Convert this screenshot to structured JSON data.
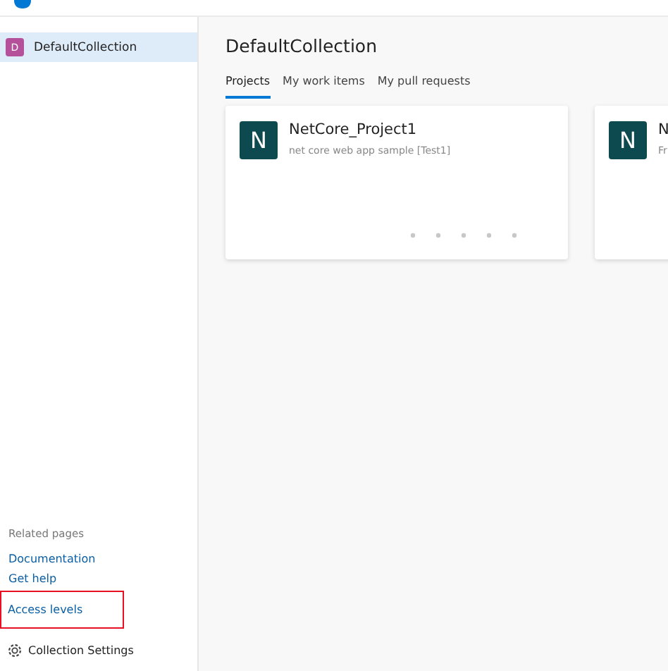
{
  "sidebar": {
    "items": [
      {
        "avatar": "D",
        "label": "DefaultCollection",
        "selected": true
      }
    ],
    "related_pages": {
      "heading": "Related pages",
      "links": [
        {
          "label": "Documentation",
          "highlighted": false
        },
        {
          "label": "Get help",
          "highlighted": false
        },
        {
          "label": "Access levels",
          "highlighted": true
        }
      ]
    },
    "settings": "Collection Settings"
  },
  "main": {
    "title": "DefaultCollection",
    "tabs": [
      {
        "label": "Projects",
        "selected": true
      },
      {
        "label": "My work items",
        "selected": false
      },
      {
        "label": "My pull requests",
        "selected": false
      }
    ],
    "projects": [
      {
        "avatar": "N",
        "name": "NetCore_Project1",
        "description": "net core web app sample [Test1]"
      },
      {
        "avatar": "N",
        "name": "N",
        "description": "Fr"
      }
    ]
  }
}
